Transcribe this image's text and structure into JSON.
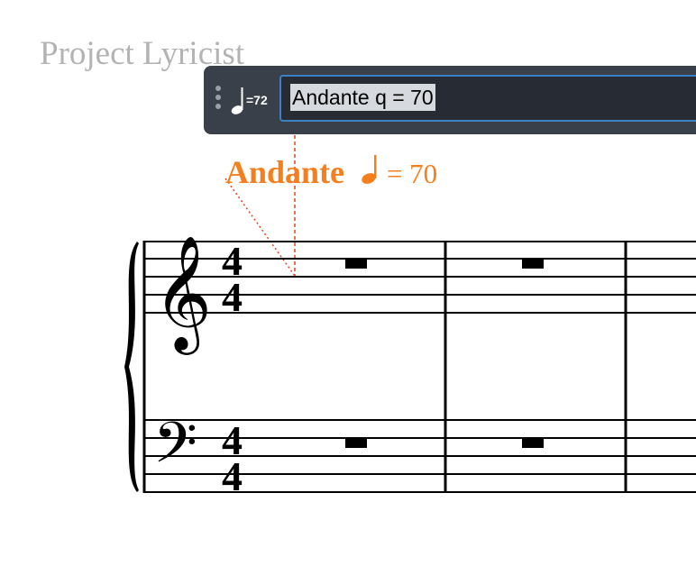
{
  "project": {
    "title": "Project Lyricist"
  },
  "popover": {
    "type_icon": "metronome-mark-icon",
    "type_label": "=72",
    "input_value": "Andante q = 70"
  },
  "score": {
    "tempo_marking": {
      "word": "Andante",
      "note_icon": "quarter-note-icon",
      "equals_text": "= 70"
    },
    "time_signature": "4/4",
    "staves": [
      "treble",
      "bass"
    ],
    "bar_count_visible": 2,
    "rests": "whole-bar rest"
  },
  "colors": {
    "tempo": "#f57f1c",
    "attachment_line": "#e8431c",
    "popover_bg": "#3a4049",
    "input_bg": "#272c34",
    "input_border": "#3c81c6",
    "selection": "#d6d9dd",
    "project_title": "#b3b3b3"
  }
}
